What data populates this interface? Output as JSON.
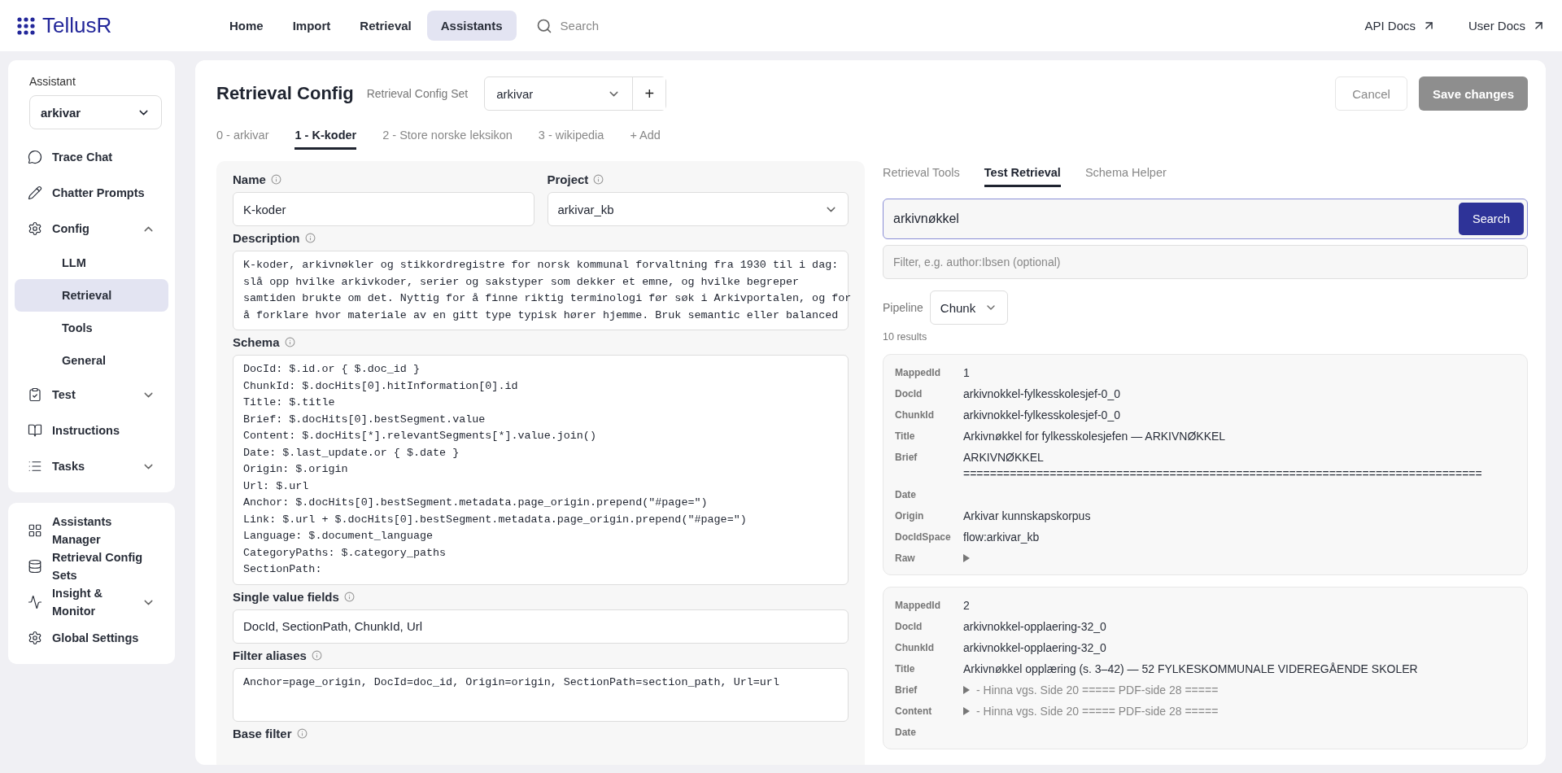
{
  "nav": {
    "brand": "TellusR",
    "links": [
      {
        "label": "Home",
        "selected": false
      },
      {
        "label": "Import",
        "selected": false
      },
      {
        "label": "Retrieval",
        "selected": false
      },
      {
        "label": "Assistants",
        "selected": true
      }
    ],
    "search": {
      "placeholder": "Search"
    },
    "docs": [
      {
        "label": "API Docs"
      },
      {
        "label": "User Docs"
      }
    ]
  },
  "sidebar": {
    "assistant_label": "Assistant",
    "assistant_value": "arkivar",
    "groups": [
      [
        {
          "label": "Trace Chat",
          "selected": false
        },
        {
          "label": "Chatter Prompts",
          "selected": false
        },
        {
          "label": "Config",
          "selected": false,
          "expanded": true,
          "children": [
            {
              "label": "LLM",
              "selected": false
            },
            {
              "label": "Retrieval",
              "selected": true
            },
            {
              "label": "Tools",
              "selected": false
            },
            {
              "label": "General",
              "selected": false
            }
          ]
        },
        {
          "label": "Test",
          "selected": false,
          "expanded": false
        },
        {
          "label": "Instructions",
          "selected": false
        },
        {
          "label": "Tasks",
          "selected": false,
          "expanded": false
        }
      ],
      [
        {
          "label": "Assistants Manager",
          "selected": false
        },
        {
          "label": "Retrieval Config Sets",
          "selected": false
        },
        {
          "label": "Insight & Monitor",
          "selected": false,
          "expanded": false
        },
        {
          "label": "Global Settings",
          "selected": false
        }
      ]
    ]
  },
  "config": {
    "title": "Retrieval Config",
    "set_label": "Retrieval Config Set",
    "set_value": "arkivar",
    "add_button": "+",
    "cancel": "Cancel",
    "save": {
      "label": "Save changes",
      "disabled": true
    },
    "tabs": [
      {
        "label": "0 - arkivar",
        "selected": false
      },
      {
        "label": "1 - K-koder",
        "selected": true
      },
      {
        "label": "2 - Store norske leksikon",
        "selected": false
      },
      {
        "label": "3 - wikipedia",
        "selected": false
      }
    ],
    "add_tab": "+ Add"
  },
  "form": {
    "name": {
      "label": "Name",
      "value": "K-koder"
    },
    "project": {
      "label": "Project",
      "value": "arkivar_kb"
    },
    "description": {
      "label": "Description",
      "lines": [
        "K-koder, arkivnøkler og stikkordregistre for norsk kommunal forvaltning fra 1930 til i dag:",
        "slå opp hvilke arkivkoder, serier og sakstyper som dekker et emne, og hvilke begreper",
        "samtiden brukte om det. Nyttig for å finne riktig terminologi før søk i Arkivportalen, og for",
        "å forklare hvor materiale av en gitt type typisk hører hjemme. Bruk semantic eller balanced"
      ]
    },
    "schema": {
      "label": "Schema",
      "lines": [
        "DocId: $.id.or { $.doc_id }",
        "ChunkId: $.docHits[0].hitInformation[0].id",
        "Title: $.title",
        "Brief: $.docHits[0].bestSegment.value",
        "Content: $.docHits[*].relevantSegments[*].value.join()",
        "Date: $.last_update.or { $.date }",
        "Origin: $.origin",
        "Url: $.url",
        "Anchor: $.docHits[0].bestSegment.metadata.page_origin.prepend(\"#page=\")",
        "Link: $.url + $.docHits[0].bestSegment.metadata.page_origin.prepend(\"#page=\")",
        "Language: $.document_language",
        "CategoryPaths: $.category_paths",
        "SectionPath:"
      ]
    },
    "single_value_fields": {
      "label": "Single value fields",
      "value": "DocId, SectionPath, ChunkId, Url"
    },
    "filter_aliases": {
      "label": "Filter aliases",
      "value": "Anchor=page_origin, DocId=doc_id, Origin=origin, SectionPath=section_path, Url=url"
    },
    "base_filter": {
      "label": "Base filter"
    }
  },
  "test": {
    "tabs": [
      {
        "label": "Retrieval Tools",
        "selected": false
      },
      {
        "label": "Test Retrieval",
        "selected": true
      },
      {
        "label": "Schema Helper",
        "selected": false
      }
    ],
    "query": "arkivnøkkel",
    "search_button": "Search",
    "filter_placeholder": "Filter, e.g. author:Ibsen (optional)",
    "pipeline_label": "Pipeline",
    "pipeline_value": "Chunk",
    "results_count": "10 results",
    "results": [
      {
        "fields": [
          {
            "label": "MappedId",
            "kind": "text",
            "value": "1"
          },
          {
            "label": "DocId",
            "kind": "text",
            "value": "arkivnokkel-fylkesskolesjef-0_0"
          },
          {
            "label": "ChunkId",
            "kind": "text",
            "value": "arkivnokkel-fylkesskolesjef-0_0"
          },
          {
            "label": "Title",
            "kind": "text",
            "value": "Arkivnøkkel for fylkesskolesjefen — ARKIVNØKKEL"
          },
          {
            "label": "Brief",
            "kind": "text",
            "value": "ARKIVNØKKEL\n=============================================================================="
          },
          {
            "label": "Date",
            "kind": "empty"
          },
          {
            "label": "Origin",
            "kind": "text",
            "value": "Arkivar kunnskapskorpus"
          },
          {
            "label": "DocIdSpace",
            "kind": "text",
            "value": "flow:arkivar_kb"
          },
          {
            "label": "Raw",
            "kind": "collapsed"
          }
        ]
      },
      {
        "fields": [
          {
            "label": "MappedId",
            "kind": "text",
            "value": "2"
          },
          {
            "label": "DocId",
            "kind": "text",
            "value": "arkivnokkel-opplaering-32_0"
          },
          {
            "label": "ChunkId",
            "kind": "text",
            "value": "arkivnokkel-opplaering-32_0"
          },
          {
            "label": "Title",
            "kind": "text",
            "value": "Arkivnøkkel opplæring (s. 3–42) — 52 FYLKESKOMMUNALE VIDEREGÅENDE SKOLER"
          },
          {
            "label": "Brief",
            "kind": "collapsed",
            "value": "- Hinna vgs. Side 20 ===== PDF-side 28 ====="
          },
          {
            "label": "Content",
            "kind": "collapsed",
            "value": "- Hinna vgs. Side 20 ===== PDF-side 28 ====="
          },
          {
            "label": "Date",
            "kind": "empty"
          }
        ]
      }
    ]
  }
}
